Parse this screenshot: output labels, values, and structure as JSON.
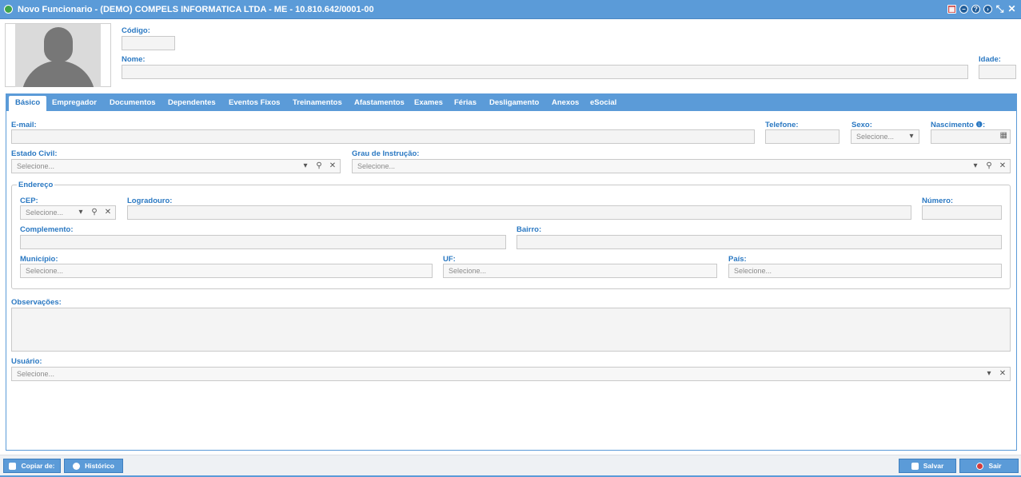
{
  "window": {
    "title": "Novo Funcionario - (DEMO) COMPELS INFORMATICA LTDA - ME - 10.810.642/0001-00",
    "controls": [
      "calendar-icon",
      "minimize-icon",
      "help-icon",
      "forward-icon",
      "restore-icon",
      "close-icon"
    ],
    "controls_glyphs": [
      "▦",
      "–",
      "?",
      "›",
      "⤡",
      "✕"
    ]
  },
  "header": {
    "codigo_label": "Código:",
    "nome_label": "Nome:",
    "idade_label": "Idade:"
  },
  "tabs": [
    {
      "label": "Básico",
      "active": true
    },
    {
      "label": "Empregador"
    },
    {
      "label": "Documentos"
    },
    {
      "label": "Dependentes"
    },
    {
      "label": "Eventos Fixos"
    },
    {
      "label": "Treinamentos"
    },
    {
      "label": "Afastamentos"
    },
    {
      "label": "Exames"
    },
    {
      "label": "Férias"
    },
    {
      "label": "Desligamento"
    },
    {
      "label": "Anexos"
    },
    {
      "label": "eSocial"
    }
  ],
  "basico": {
    "email_label": "E-mail:",
    "telefone_label": "Telefone:",
    "sexo_label": "Sexo:",
    "sexo_placeholder": "Selecione...",
    "nascimento_label": "Nascimento ❶:",
    "estado_civil_label": "Estado Civil:",
    "estado_civil_placeholder": "Selecione...",
    "grau_instrucao_label": "Grau de Instrução:",
    "grau_instrucao_placeholder": "Selecione...",
    "endereco_legend": "Endereço",
    "cep_label": "CEP:",
    "cep_placeholder": "Selecione...",
    "logradouro_label": "Logradouro:",
    "numero_label": "Número:",
    "complemento_label": "Complemento:",
    "bairro_label": "Bairro:",
    "municipio_label": "Município:",
    "municipio_placeholder": "Selecione...",
    "uf_label": "UF:",
    "uf_placeholder": "Selecione...",
    "pais_label": "País:",
    "pais_placeholder": "Selecione...",
    "observacoes_label": "Observações:",
    "usuario_label": "Usuário:",
    "usuario_placeholder": "Selecione..."
  },
  "footer": {
    "copiar_label": "Copiar de:",
    "historico_label": "Histórico",
    "salvar_label": "Salvar",
    "sair_label": "Sair"
  },
  "colors": {
    "accent": "#5b9bd8",
    "label": "#2a78c2",
    "field_bg": "#f4f4f4"
  }
}
